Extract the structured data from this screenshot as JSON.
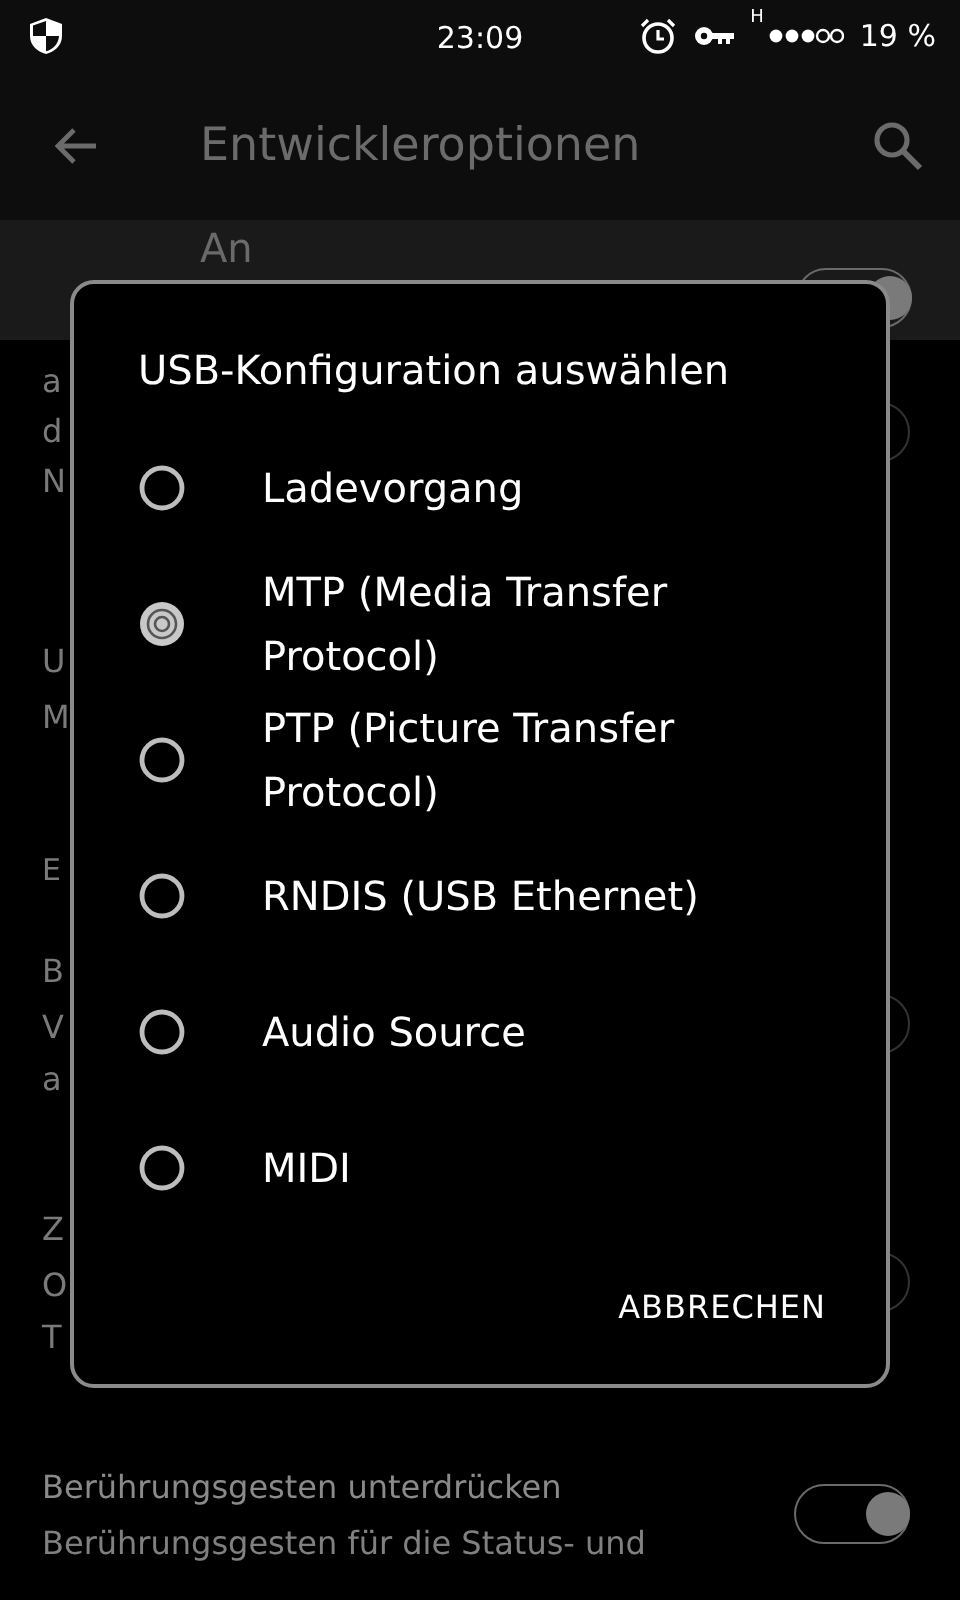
{
  "status_bar": {
    "time": "23:09",
    "network": "H",
    "battery": "19 %"
  },
  "app_bar": {
    "title": "Entwickleroptionen"
  },
  "master_switch": {
    "label": "An",
    "on": true
  },
  "settings": [
    {
      "kind": "description",
      "lines": [
        "a",
        "d",
        "N"
      ],
      "on": false
    },
    {
      "kind": "item",
      "title": "U",
      "lines": [
        "M"
      ]
    },
    {
      "kind": "header",
      "title": "E"
    },
    {
      "kind": "switch",
      "title": "B",
      "lines": [
        "V",
        "a"
      ],
      "on": false
    },
    {
      "kind": "switch",
      "title": "Z",
      "lines": [
        "O",
        "T"
      ],
      "on": false
    },
    {
      "kind": "switch",
      "title": "Berührungsgesten unterdrücken",
      "lines": [
        "Berührungsgesten für die Status- und"
      ],
      "on": true
    }
  ],
  "dialog": {
    "title": "USB-Konfiguration auswählen",
    "options": [
      {
        "label": "Ladevorgang",
        "selected": false
      },
      {
        "label": "MTP (Media Transfer Protocol)",
        "selected": true
      },
      {
        "label": "PTP (Picture Transfer Protocol)",
        "selected": false
      },
      {
        "label": "RNDIS (USB Ethernet)",
        "selected": false
      },
      {
        "label": "Audio Source",
        "selected": false
      },
      {
        "label": "MIDI",
        "selected": false
      }
    ],
    "cancel": "ABBRECHEN"
  }
}
